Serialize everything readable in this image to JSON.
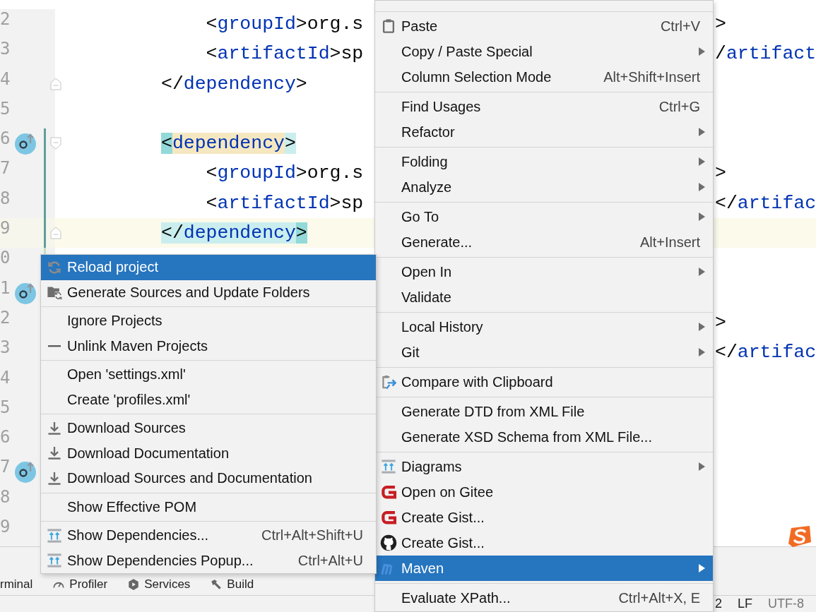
{
  "editor": {
    "lines": [
      {
        "number": "2",
        "current": false,
        "code": [
          {
            "text": "    <",
            "kind": "bracket"
          },
          {
            "text": "groupId",
            "kind": "tag"
          },
          {
            "text": ">org.s",
            "kind": "value"
          }
        ],
        "tail": [
          {
            "text": ">",
            "kind": "bracket"
          }
        ]
      },
      {
        "number": "3",
        "current": false,
        "code": [
          {
            "text": "    <",
            "kind": "bracket"
          },
          {
            "text": "artifactId",
            "kind": "tag"
          },
          {
            "text": ">sp",
            "kind": "value"
          }
        ],
        "tail": [
          {
            "text": "/",
            "kind": "bracket"
          },
          {
            "text": "artifact",
            "kind": "tag"
          }
        ]
      },
      {
        "number": "4",
        "current": false,
        "fold": {
          "kind": "end"
        },
        "code": [
          {
            "text": "</",
            "kind": "bracket"
          },
          {
            "text": "dependency",
            "kind": "tag"
          },
          {
            "text": ">",
            "kind": "bracket"
          }
        ]
      },
      {
        "number": "5",
        "current": false
      },
      {
        "number": "6",
        "current": false,
        "gutter_icon": true,
        "fold": {
          "kind": "start"
        },
        "change": {
          "color": "#5f9e9a"
        },
        "code": [
          {
            "text": "<",
            "kind": "bracket",
            "color": "#93d9d9"
          },
          {
            "text": "dependency",
            "kind": "tag",
            "color": "#f5e8c1"
          },
          {
            "text": ">",
            "kind": "bracket",
            "color": "#caeeee"
          }
        ]
      },
      {
        "number": "7",
        "current": false,
        "change": {
          "color": "#5f9e9a"
        },
        "code": [
          {
            "text": "    <",
            "kind": "bracket"
          },
          {
            "text": "groupId",
            "kind": "tag"
          },
          {
            "text": ">org.s",
            "kind": "value"
          }
        ],
        "tail": [
          {
            "text": ">",
            "kind": "bracket"
          }
        ]
      },
      {
        "number": "8",
        "current": false,
        "change": {
          "color": "#5f9e9a"
        },
        "code": [
          {
            "text": "    <",
            "kind": "bracket"
          },
          {
            "text": "artifactId",
            "kind": "tag"
          },
          {
            "text": ">sp",
            "kind": "value"
          }
        ],
        "tail": [
          {
            "text": "</",
            "kind": "bracket"
          },
          {
            "text": "artifac",
            "kind": "tag"
          }
        ]
      },
      {
        "number": "9",
        "current": true,
        "fold": {
          "kind": "end"
        },
        "change": {
          "color": "#5f9e9a"
        },
        "code": [
          {
            "text": "</",
            "kind": "bracket",
            "color": "#caeeee"
          },
          {
            "text": "dependency",
            "kind": "tag",
            "color": "#caeeee"
          },
          {
            "text": ">",
            "kind": "bracket",
            "color": "#93d9d9"
          }
        ]
      },
      {
        "number": "0",
        "current": false,
        "change": {
          "color": "#c5dfc0"
        }
      },
      {
        "number": "1",
        "current": false,
        "gutter_icon": true
      },
      {
        "number": "2",
        "current": false,
        "tail": [
          {
            "text": ">",
            "kind": "bracket"
          }
        ]
      },
      {
        "number": "3",
        "current": false,
        "tail": [
          {
            "text": "</",
            "kind": "bracket"
          },
          {
            "text": "artifac",
            "kind": "tag"
          }
        ]
      },
      {
        "number": "4",
        "current": false
      },
      {
        "number": "5",
        "current": false
      },
      {
        "number": "6",
        "current": false
      },
      {
        "number": "7",
        "current": false,
        "gutter_icon": true
      },
      {
        "number": "8",
        "current": false
      },
      {
        "number": "9",
        "current": false
      }
    ]
  },
  "context_menu": {
    "groups": [
      {
        "items": [
          {
            "label": "Paste",
            "shortcut": "Ctrl+V",
            "kind": "paste",
            "selected": false
          },
          {
            "label": "Copy / Paste Special",
            "submenu": true,
            "selected": false
          },
          {
            "label": "Column Selection Mode",
            "shortcut": "Alt+Shift+Insert",
            "selected": false
          }
        ]
      },
      {
        "items": [
          {
            "label": "Find Usages",
            "shortcut": "Ctrl+G",
            "selected": false
          },
          {
            "label": "Refactor",
            "submenu": true,
            "selected": false
          }
        ]
      },
      {
        "items": [
          {
            "label": "Folding",
            "submenu": true,
            "selected": false
          },
          {
            "label": "Analyze",
            "submenu": true,
            "selected": false
          }
        ]
      },
      {
        "items": [
          {
            "label": "Go To",
            "submenu": true,
            "selected": false
          },
          {
            "label": "Generate...",
            "shortcut": "Alt+Insert",
            "selected": false
          }
        ]
      },
      {
        "items": [
          {
            "label": "Open In",
            "submenu": true,
            "selected": false
          },
          {
            "label": "Validate",
            "selected": false
          }
        ]
      },
      {
        "items": [
          {
            "label": "Local History",
            "submenu": true,
            "selected": false
          },
          {
            "label": "Git",
            "submenu": true,
            "selected": false
          }
        ]
      },
      {
        "items": [
          {
            "label": "Compare with Clipboard",
            "kind": "compare",
            "selected": false
          }
        ]
      },
      {
        "items": [
          {
            "label": "Generate DTD from XML File",
            "selected": false
          },
          {
            "label": "Generate XSD Schema from XML File...",
            "selected": false
          }
        ]
      },
      {
        "items": [
          {
            "label": "Diagrams",
            "kind": "diagram",
            "submenu": true,
            "selected": false
          },
          {
            "label": "Open on Gitee",
            "kind": "gitee",
            "selected": false
          },
          {
            "label": "Create Gist...",
            "kind": "gitee",
            "selected": false
          },
          {
            "label": "Create Gist...",
            "kind": "github",
            "selected": false
          },
          {
            "label": "Maven",
            "kind": "maven",
            "submenu": true,
            "selected": true
          }
        ]
      },
      {
        "items": [
          {
            "label": "Evaluate XPath...",
            "shortcut": "Ctrl+Alt+X, E",
            "selected": false
          }
        ]
      }
    ]
  },
  "maven_submenu": {
    "groups": [
      {
        "items": [
          {
            "label": "Reload project",
            "kind": "reload",
            "selected": true
          },
          {
            "label": "Generate Sources and Update Folders",
            "kind": "folder-sync",
            "selected": false
          }
        ]
      },
      {
        "items": [
          {
            "label": "Ignore Projects",
            "selected": false
          },
          {
            "label": "Unlink Maven Projects",
            "kind": "minus",
            "selected": false
          }
        ]
      },
      {
        "items": [
          {
            "label": "Open 'settings.xml'",
            "selected": false
          },
          {
            "label": "Create 'profiles.xml'",
            "selected": false
          }
        ]
      },
      {
        "items": [
          {
            "label": "Download Sources",
            "kind": "download",
            "selected": false
          },
          {
            "label": "Download Documentation",
            "kind": "download",
            "selected": false
          },
          {
            "label": "Download Sources and Documentation",
            "kind": "download",
            "selected": false
          }
        ]
      },
      {
        "items": [
          {
            "label": "Show Effective POM",
            "selected": false
          }
        ]
      },
      {
        "items": [
          {
            "label": "Show Dependencies...",
            "shortcut": "Ctrl+Alt+Shift+U",
            "kind": "diagram",
            "selected": false
          },
          {
            "label": "Show Dependencies Popup...",
            "shortcut": "Ctrl+Alt+U",
            "kind": "diagram",
            "selected": false
          }
        ]
      }
    ]
  },
  "tool_window_bar": {
    "tabs": [
      {
        "label": "rminal"
      },
      {
        "label": "Profiler",
        "kind": "profiler"
      },
      {
        "label": "Services",
        "kind": "services"
      },
      {
        "label": "Build",
        "kind": "build"
      }
    ]
  },
  "status_bar": {
    "items": [
      "2",
      "LF",
      "UTF-8"
    ]
  }
}
